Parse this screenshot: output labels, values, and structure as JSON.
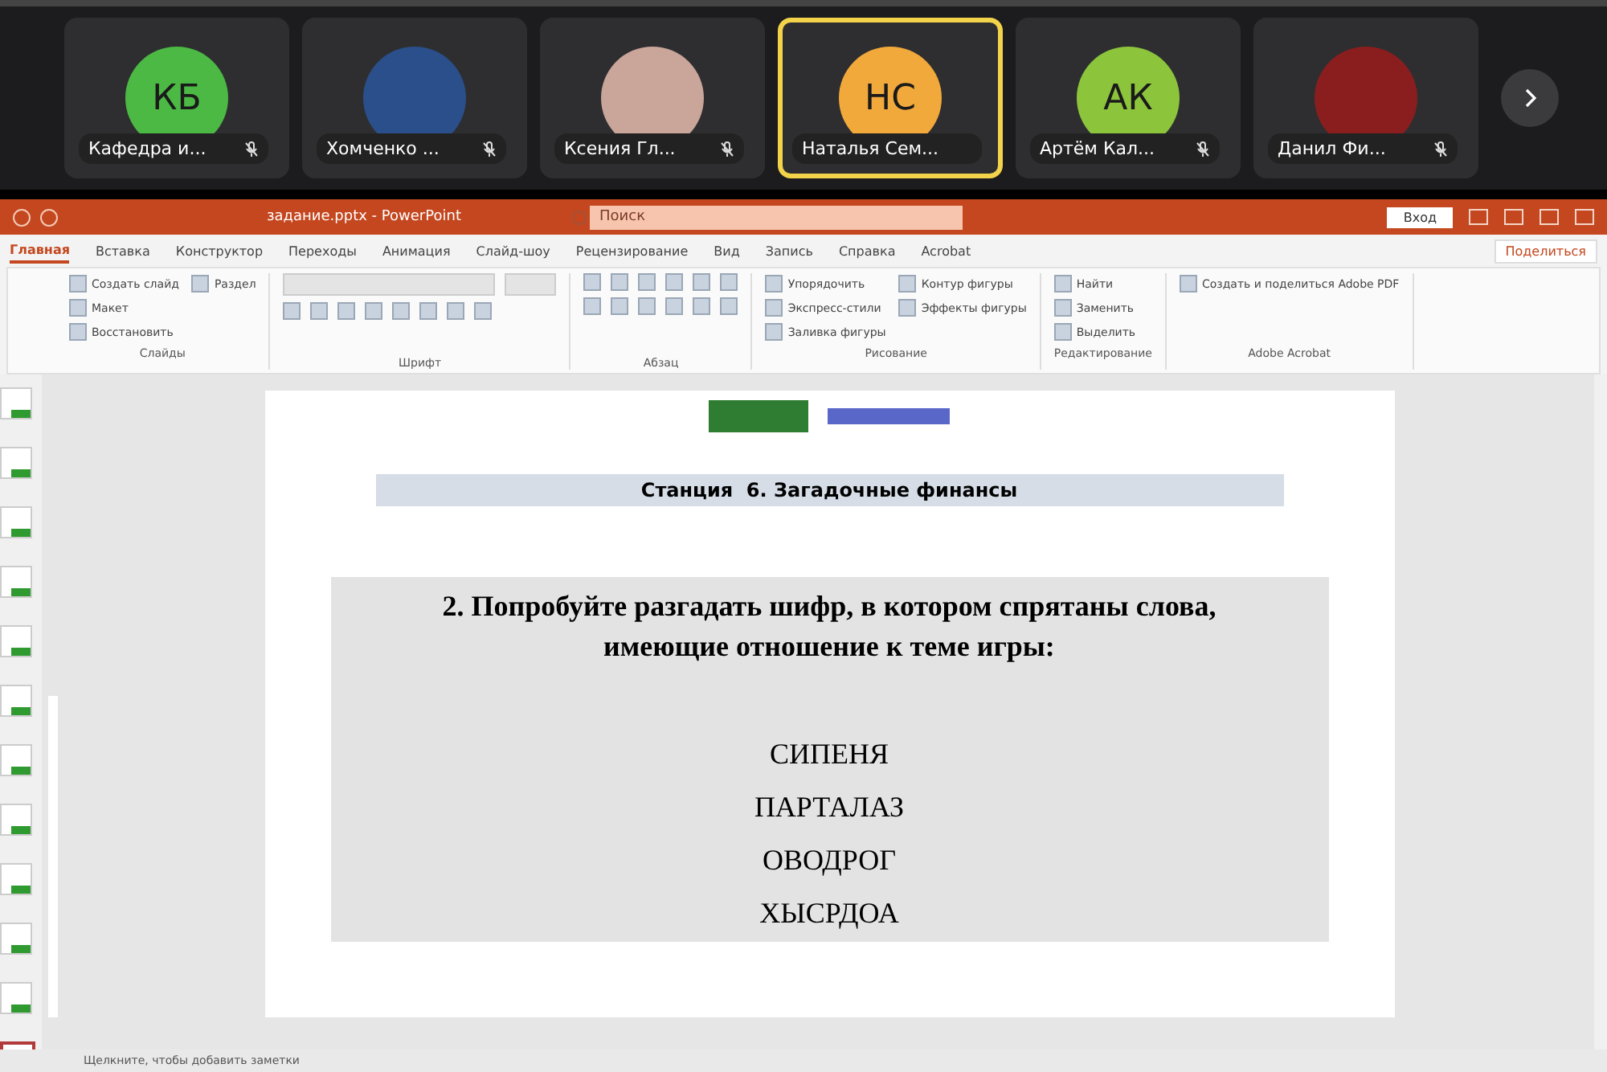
{
  "call_strip": {
    "participants": [
      {
        "name": "Кафедра и...",
        "initials": "КБ",
        "kind": "initials",
        "color": "#4cb944",
        "muted": true,
        "speaking": false
      },
      {
        "name": "Хомченко ...",
        "kind": "photo",
        "color": "#2a4f8a",
        "muted": true,
        "speaking": false
      },
      {
        "name": "Ксения Гл...",
        "kind": "photo",
        "color": "#c9a59a",
        "muted": true,
        "speaking": false
      },
      {
        "name": "Наталья Сем...",
        "initials": "НС",
        "kind": "initials",
        "color": "#f2a93b",
        "muted": false,
        "speaking": true
      },
      {
        "name": "Артём Кал...",
        "initials": "АК",
        "kind": "initials",
        "color": "#8cc43c",
        "muted": true,
        "speaking": false
      },
      {
        "name": "Данил Фи...",
        "kind": "photo",
        "color": "#8a1e1e",
        "muted": true,
        "speaking": false
      }
    ]
  },
  "window": {
    "title": "задание.pptx - PowerPoint",
    "search": {
      "placeholder": "Поиск"
    },
    "sign_in": "Вход"
  },
  "ribbon": {
    "tabs": [
      {
        "label": "Главная",
        "selected": true
      },
      {
        "label": "Вставка",
        "selected": false
      },
      {
        "label": "Конструктор",
        "selected": false
      },
      {
        "label": "Переходы",
        "selected": false
      },
      {
        "label": "Анимация",
        "selected": false
      },
      {
        "label": "Слайд-шоу",
        "selected": false
      },
      {
        "label": "Рецензирование",
        "selected": false
      },
      {
        "label": "Вид",
        "selected": false
      },
      {
        "label": "Запись",
        "selected": false
      },
      {
        "label": "Справка",
        "selected": false
      },
      {
        "label": "Acrobat",
        "selected": false
      }
    ],
    "share": "Поделиться",
    "groups": [
      {
        "label": "Слайды",
        "kind": "buttons",
        "items": [
          "Создать слайд",
          "Макет",
          "Восстановить",
          "Раздел"
        ]
      },
      {
        "label": "Шрифт",
        "kind": "font"
      },
      {
        "label": "Абзац",
        "kind": "paragraph"
      },
      {
        "label": "Рисование",
        "kind": "buttons",
        "items": [
          "Упорядочить",
          "Экспресс-стили",
          "Заливка фигуры",
          "Контур фигуры",
          "Эффекты фигуры"
        ]
      },
      {
        "label": "Редактирование",
        "kind": "buttons",
        "items": [
          "Найти",
          "Заменить",
          "Выделить"
        ]
      },
      {
        "label": "Adobe Acrobat",
        "kind": "buttons",
        "items": [
          "Создать и поделиться Adobe PDF"
        ]
      }
    ]
  },
  "thumbnails": [
    {
      "selected": false
    },
    {
      "selected": false
    },
    {
      "selected": false
    },
    {
      "selected": false
    },
    {
      "selected": false
    },
    {
      "selected": false
    },
    {
      "selected": false
    },
    {
      "selected": false
    },
    {
      "selected": false
    },
    {
      "selected": false
    },
    {
      "selected": false
    },
    {
      "selected": true
    }
  ],
  "slide": {
    "title": "Станция  6. Загадочные финансы",
    "task": "2. Попробуйте разгадать шифр, в котором спрятаны слова, имеющие отношение к теме игры:",
    "words": [
      "СИПЕНЯ",
      "ПАРТАЛАЗ",
      "ОВОДРОГ",
      "ХЫСРДОА"
    ]
  },
  "notes": {
    "placeholder": "Щелкните, чтобы добавить заметки"
  }
}
